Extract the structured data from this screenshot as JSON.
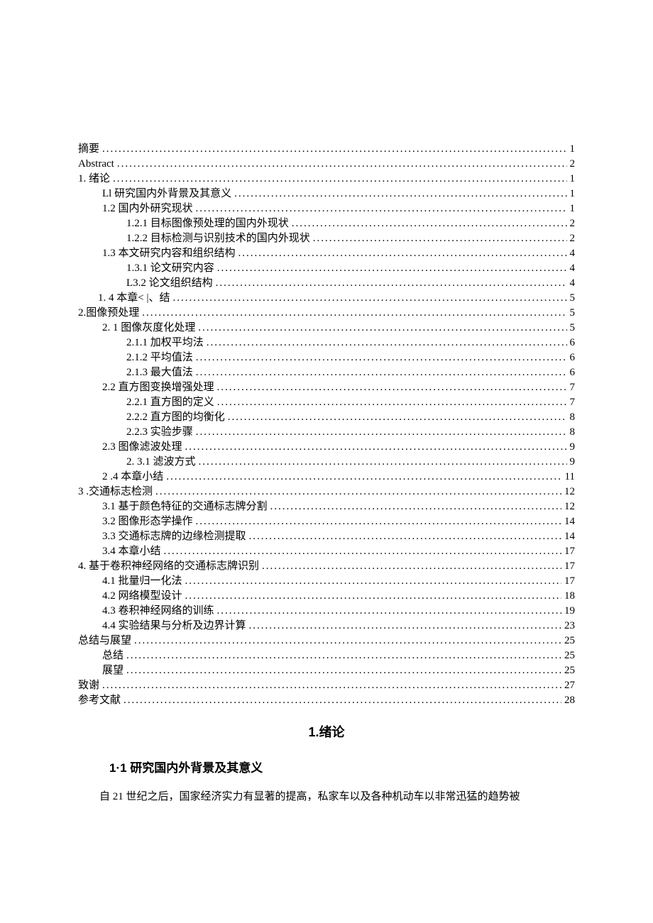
{
  "toc": [
    {
      "indent": 0,
      "label": "摘要",
      "page": "1"
    },
    {
      "indent": 0,
      "label": "Abstract",
      "page": "2"
    },
    {
      "indent": 0,
      "label": "1.  绪论",
      "page": "1"
    },
    {
      "indent": 1,
      "label": "Ll 研究国内外背景及其意义",
      "page": "1"
    },
    {
      "indent": 1,
      "label": "1.2  国内外研究现状",
      "page": "1"
    },
    {
      "indent": 2,
      "label": "1.2.1  目标图像预处理的国内外现状",
      "page": "2"
    },
    {
      "indent": 2,
      "label": "1.2.2  目标检测与识别技术的国内外现状",
      "page": "2"
    },
    {
      "indent": 1,
      "label": "1.3  本文研究内容和组织结构",
      "page": "4"
    },
    {
      "indent": 2,
      "label": "1.3.1 论文研究内容",
      "page": "4"
    },
    {
      "indent": 2,
      "label": "L3.2 论文组织结构",
      "page": "4"
    },
    {
      "indent": 3,
      "label": "1.  4 本章< |、结",
      "page": "5"
    },
    {
      "indent": 0,
      "label": "2.图像预处理",
      "page": "5"
    },
    {
      "indent": 1,
      "label": "2.  1 图像灰度化处理",
      "page": "5"
    },
    {
      "indent": 2,
      "label": "2.1.1 加权平均法",
      "page": "6"
    },
    {
      "indent": 2,
      "label": "2.1.2 平均值法",
      "page": "6"
    },
    {
      "indent": 2,
      "label": "2.1.3 最大值法",
      "page": "6"
    },
    {
      "indent": 1,
      "label": "2.2 直方图变换增强处理",
      "page": "7"
    },
    {
      "indent": 2,
      "label": "2.2.1 直方图的定义",
      "page": "7"
    },
    {
      "indent": 2,
      "label": "2.2.2 直方图的均衡化",
      "page": "8"
    },
    {
      "indent": 2,
      "label": "2.2.3 实验步骤",
      "page": "8"
    },
    {
      "indent": 1,
      "label": "2.3 图像滤波处理",
      "page": "9"
    },
    {
      "indent": 2,
      "label": "2.  3.1 滤波方式",
      "page": "9"
    },
    {
      "indent": 1,
      "label": "2  .4 本章小结",
      "page": "11"
    },
    {
      "indent": 0,
      "label": "3  .交通标志检测",
      "page": "12"
    },
    {
      "indent": 1,
      "label": "3.1  基于颜色特征的交通标志牌分割",
      "page": "12"
    },
    {
      "indent": 1,
      "label": "3.2 图像形态学操作",
      "page": "14"
    },
    {
      "indent": 1,
      "label": "3.3 交通标志牌的边缘检测提取",
      "page": "14"
    },
    {
      "indent": 1,
      "label": "3.4 本章小结",
      "page": "17"
    },
    {
      "indent": 0,
      "label": "4. 基于卷积神经网络的交通标志牌识别",
      "page": "17"
    },
    {
      "indent": 1,
      "label": "4.1 批量归一化法",
      "page": "17"
    },
    {
      "indent": 1,
      "label": "4.2 网络模型设计",
      "page": "18"
    },
    {
      "indent": 1,
      "label": "4.3 卷积神经网络的训练",
      "page": "19"
    },
    {
      "indent": 1,
      "label": "4.4 实验结果与分析及边界计算",
      "page": "23"
    },
    {
      "indent": 0,
      "label": "总结与展望",
      "page": "25"
    },
    {
      "indent": 1,
      "label": "总结",
      "page": "25"
    },
    {
      "indent": 1,
      "label": "展望",
      "page": "25"
    },
    {
      "indent": 0,
      "label": "致谢",
      "page": "27"
    },
    {
      "indent": 0,
      "label": "参考文献",
      "page": "28"
    }
  ],
  "chapter_title": "1.绪论",
  "section_title": "1·1 研究国内外背景及其意义",
  "paragraph": "自 21 世纪之后，国家经济实力有显著的提高，私家车以及各种机动车以非常迅猛的趋势被"
}
